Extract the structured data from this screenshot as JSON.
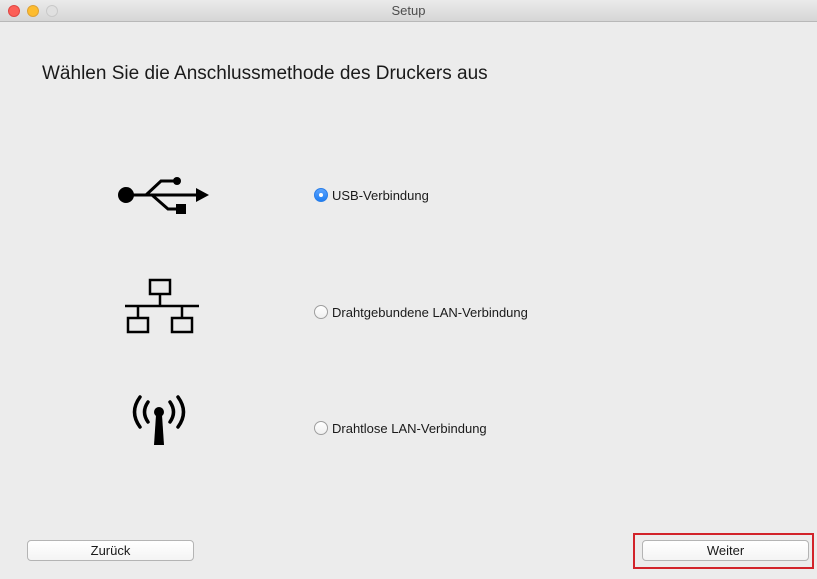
{
  "window": {
    "title": "Setup"
  },
  "heading": "Wählen Sie die Anschlussmethode des Druckers aus",
  "options": [
    {
      "icon": "usb-icon",
      "label": "USB-Verbindung",
      "selected": true
    },
    {
      "icon": "wired-lan-icon",
      "label": "Drahtgebundene LAN-Verbindung",
      "selected": false
    },
    {
      "icon": "wireless-lan-icon",
      "label": "Drahtlose LAN-Verbindung",
      "selected": false
    }
  ],
  "buttons": {
    "back_label": "Zurück",
    "next_label": "Weiter"
  },
  "colors": {
    "accent": "#1f7ef3",
    "highlight": "#d2232a"
  }
}
